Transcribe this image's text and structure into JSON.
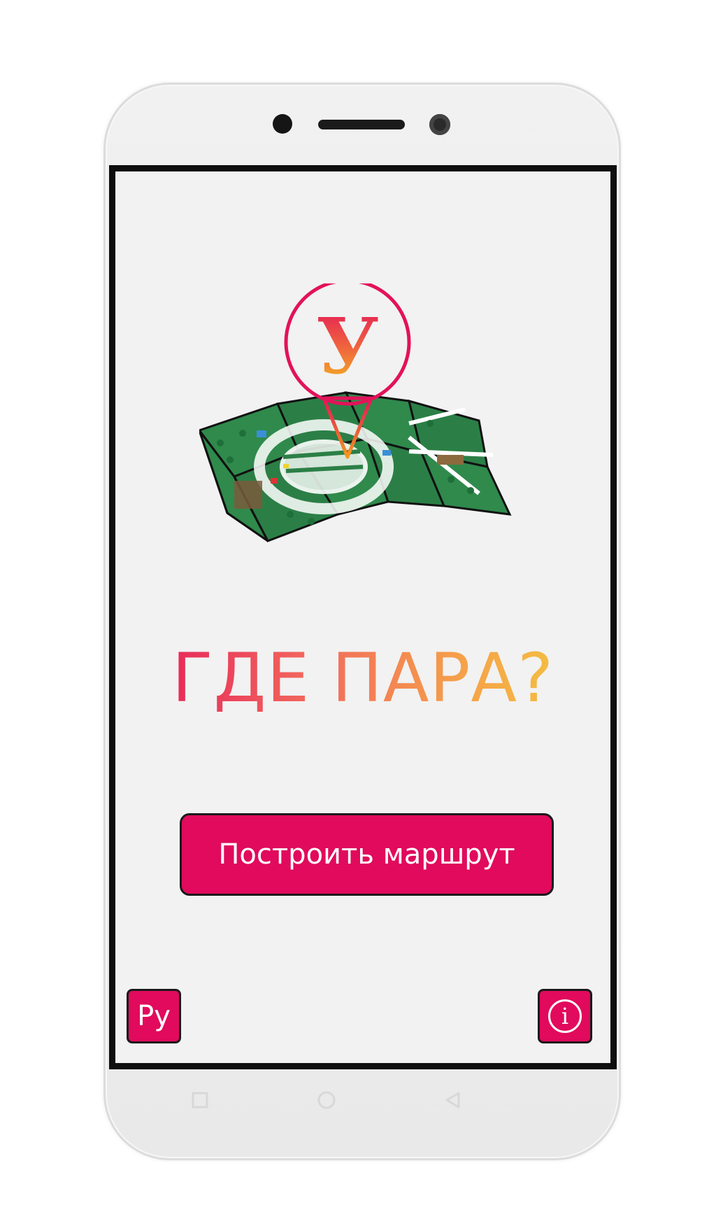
{
  "app": {
    "title": "ГДЕ ПАРА?",
    "logo_letter": "У",
    "logo_name": "university-map-logo"
  },
  "actions": {
    "build_route_label": "Построить маршрут",
    "language_label": "Ру",
    "info_icon": "info-icon"
  },
  "navigation": {
    "recent_icon": "square-icon",
    "home_icon": "circle-icon",
    "back_icon": "triangle-back-icon"
  },
  "colors": {
    "accent": "#e10a5c",
    "title_gradient": [
      "#e3125a",
      "#f26a5c",
      "#f5a14a",
      "#f4cd3c"
    ],
    "map_green": "#2f8a4c",
    "screen_bg": "#f2f2f2"
  }
}
